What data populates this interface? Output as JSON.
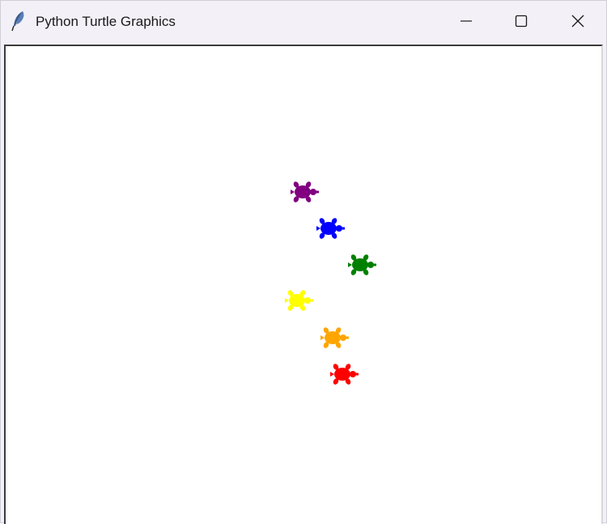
{
  "window": {
    "title": "Python Turtle Graphics",
    "icon": "feather-icon",
    "controls": [
      "minimize-icon",
      "maximize-icon",
      "close-icon"
    ]
  },
  "canvas": {
    "background": "#ffffff",
    "turtles": [
      {
        "color": "purple"
      },
      {
        "color": "blue"
      },
      {
        "color": "green"
      },
      {
        "color": "yellow"
      },
      {
        "color": "orange"
      },
      {
        "color": "red"
      }
    ]
  }
}
